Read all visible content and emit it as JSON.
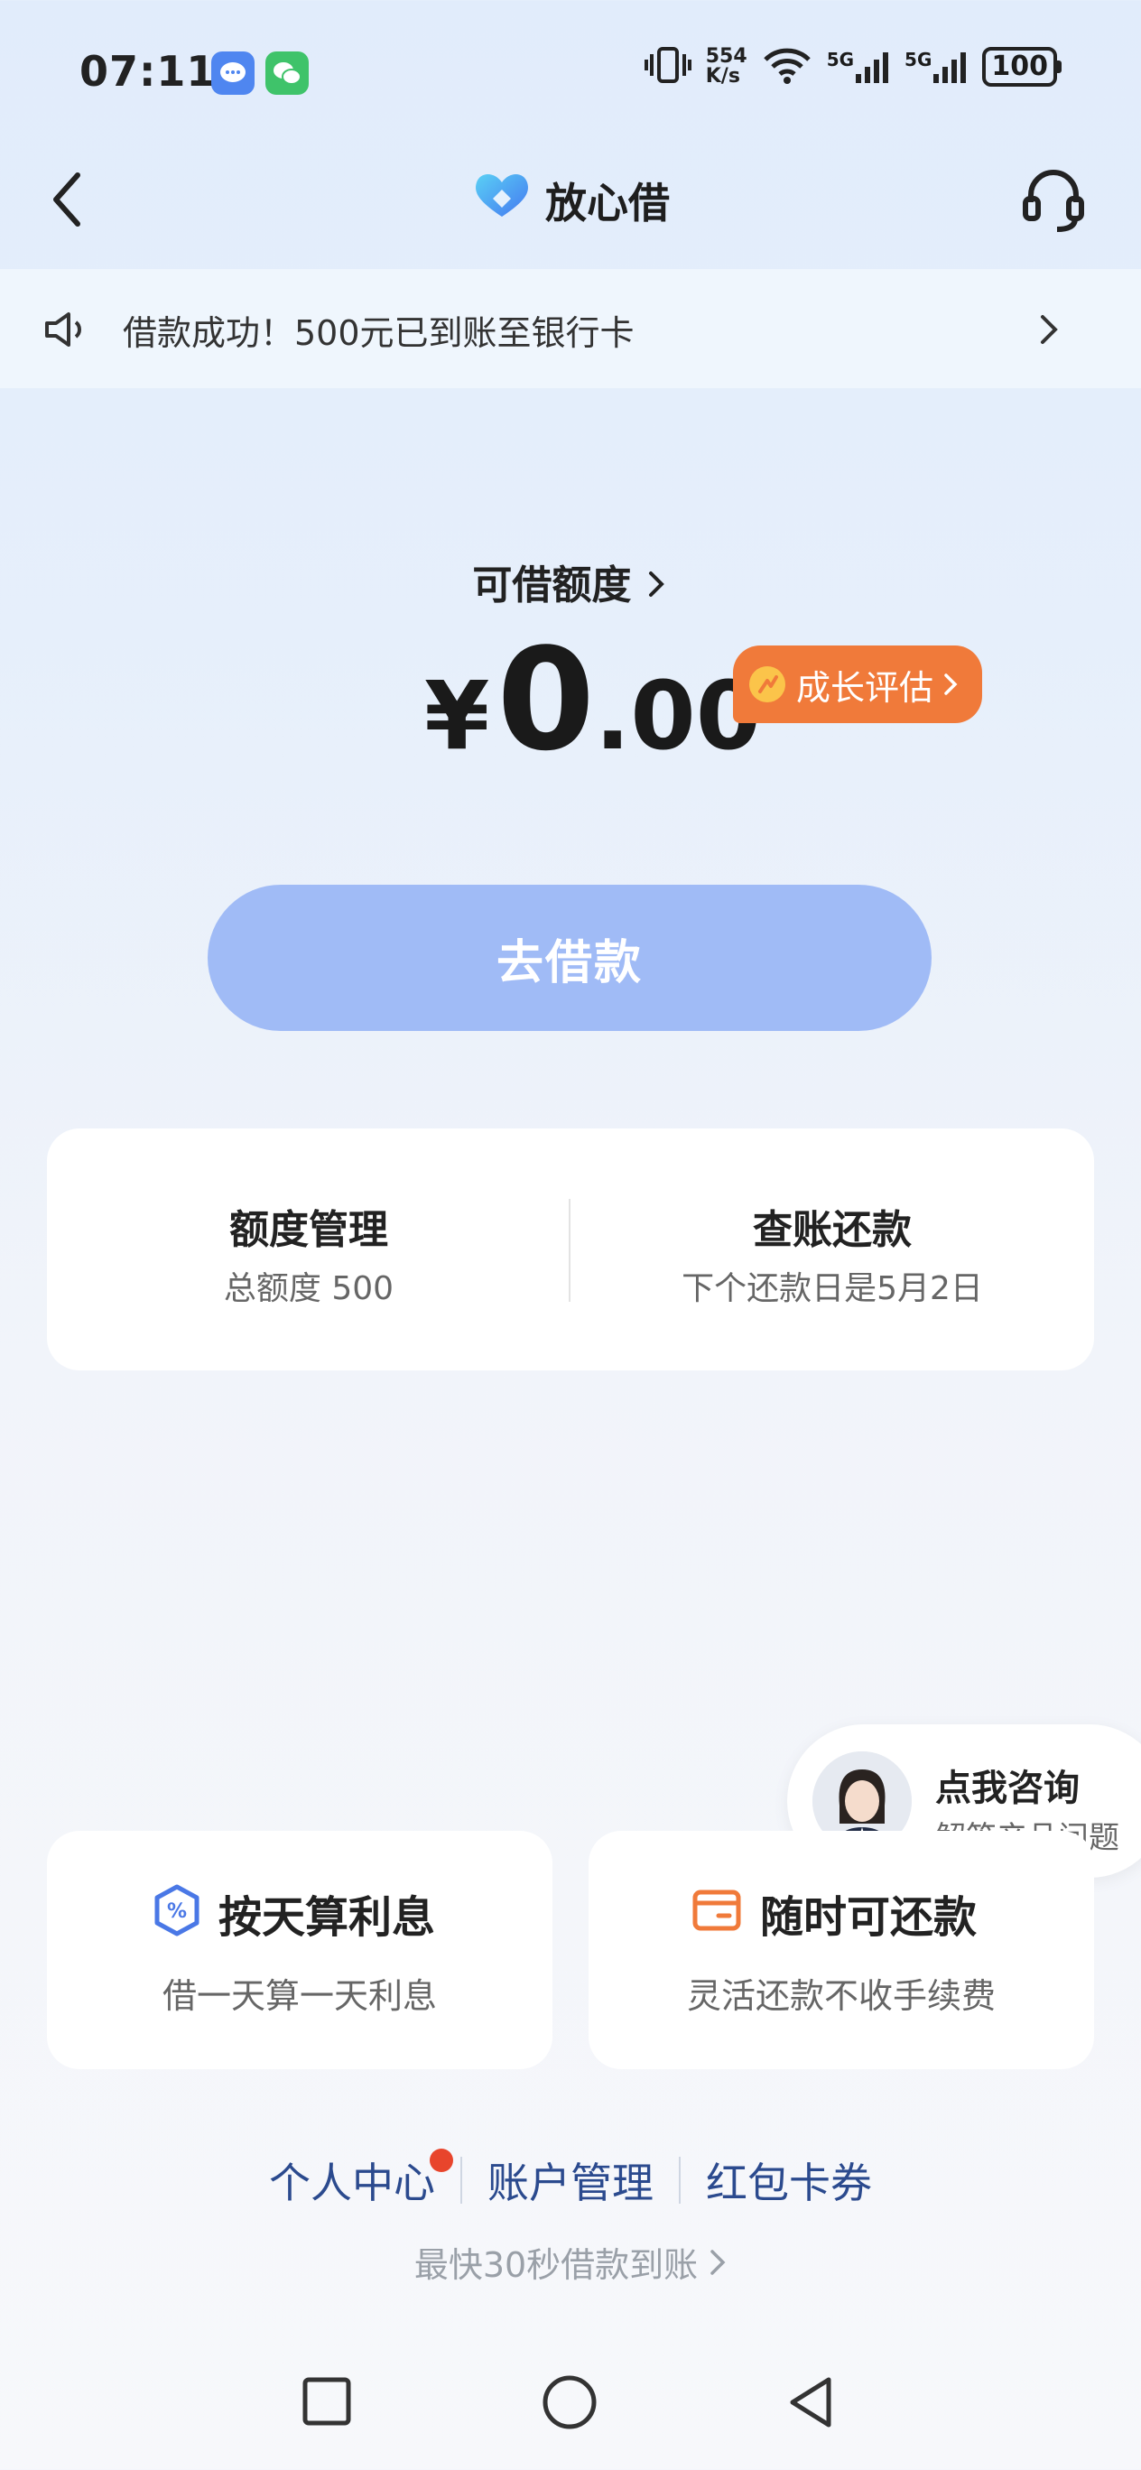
{
  "status_bar": {
    "time": "07:11",
    "net_speed_top": "554",
    "net_speed_bottom": "K/s",
    "sim1": "5G",
    "sim2": "5G",
    "battery": "100"
  },
  "nav": {
    "title": "放心借"
  },
  "notice": {
    "text": "借款成功！500元已到账至银行卡"
  },
  "quota": {
    "label": "可借额度",
    "currency": "¥",
    "amount_int": "0",
    "amount_dec": ".00",
    "growth_label": "成长评估"
  },
  "borrow_button": "去借款",
  "manage": {
    "left_title": "额度管理",
    "left_sub": "总额度 500",
    "right_title": "查账还款",
    "right_sub": "下个还款日是5月2日"
  },
  "consult": {
    "title": "点我咨询",
    "sub": "解答产品问题"
  },
  "features": [
    {
      "title": "按天算利息",
      "sub": "借一天算一天利息",
      "icon_text": "%"
    },
    {
      "title": "随时可还款",
      "sub": "灵活还款不收手续费"
    }
  ],
  "footer": {
    "links": [
      "个人中心",
      "账户管理",
      "红包卡券"
    ],
    "tagline": "最快30秒借款到账"
  },
  "colors": {
    "accent_orange": "#f07a3a",
    "button_blue": "#a0bbf6",
    "link_blue": "#2b4a8e",
    "badge_red": "#e8452c"
  }
}
